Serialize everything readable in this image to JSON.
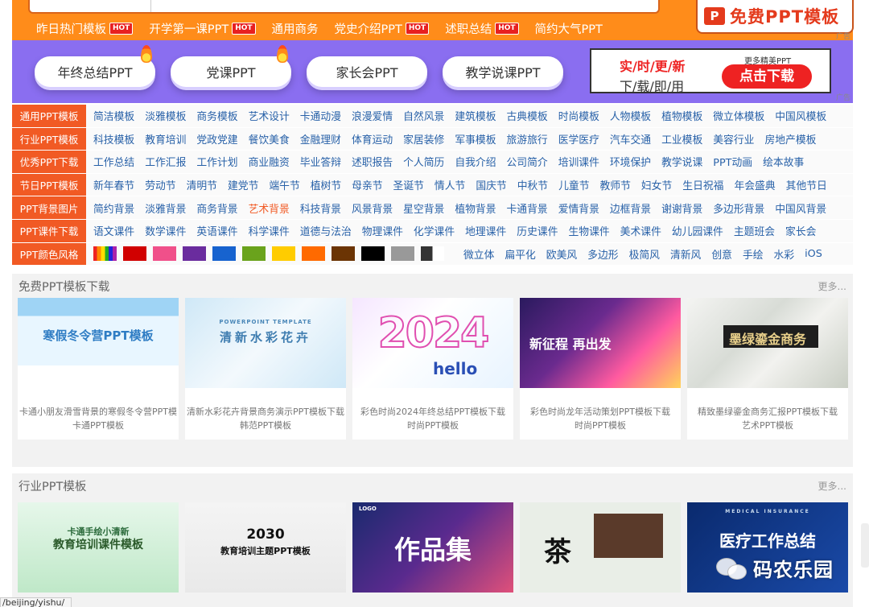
{
  "top": {
    "hotlinks": [
      {
        "label": "昨日热门模板",
        "hot": true
      },
      {
        "label": "开学第一课PPT",
        "hot": true
      },
      {
        "label": "通用商务",
        "hot": false
      },
      {
        "label": "党史介绍PPT",
        "hot": true
      },
      {
        "label": "述职总结",
        "hot": true
      },
      {
        "label": "简约大气PPT",
        "hot": false
      }
    ],
    "hot_badge": "HOT",
    "free_banner": "免费PPT模板",
    "ppt_icon": "P",
    "ad_tag": "广告"
  },
  "promo": {
    "pills": [
      {
        "label": "年终总结PPT",
        "flame": true
      },
      {
        "label": "党课PPT",
        "flame": true
      },
      {
        "label": "家长会PPT",
        "flame": false
      },
      {
        "label": "教学说课PPT",
        "flame": false
      }
    ],
    "ad_line1": "实/时/更/新",
    "ad_line2": "下/载/即/用",
    "ad_more": "更多精美PPT",
    "ad_button": "点击下载",
    "ad_tag": "广告"
  },
  "categories": [
    {
      "label": "通用PPT模板",
      "items": [
        "简洁模板",
        "淡雅模板",
        "商务模板",
        "艺术设计",
        "卡通动漫",
        "浪漫爱情",
        "自然风景",
        "建筑模板",
        "古典模板",
        "时尚模板",
        "人物模板",
        "植物模板",
        "微立体模板",
        "中国风模板"
      ]
    },
    {
      "label": "行业PPT模板",
      "items": [
        "科技模板",
        "教育培训",
        "党政党建",
        "餐饮美食",
        "金融理财",
        "体育运动",
        "家居装修",
        "军事模板",
        "旅游旅行",
        "医学医疗",
        "汽车交通",
        "工业模板",
        "美容行业",
        "房地产模板"
      ]
    },
    {
      "label": "优秀PPT下载",
      "items": [
        "工作总结",
        "工作汇报",
        "工作计划",
        "商业融资",
        "毕业答辩",
        "述职报告",
        "个人简历",
        "自我介绍",
        "公司简介",
        "培训课件",
        "环境保护",
        "教学说课",
        "PPT动画",
        "绘本故事"
      ]
    },
    {
      "label": "节日PPT模板",
      "items": [
        "新年春节",
        "劳动节",
        "清明节",
        "建党节",
        "端午节",
        "植树节",
        "母亲节",
        "圣诞节",
        "情人节",
        "国庆节",
        "中秋节",
        "儿童节",
        "教师节",
        "妇女节",
        "生日祝福",
        "年会盛典",
        "其他节日"
      ]
    },
    {
      "label": "PPT背景图片",
      "items": [
        "简约背景",
        "淡雅背景",
        "商务背景",
        "艺术背景",
        "科技背景",
        "风景背景",
        "星空背景",
        "植物背景",
        "卡通背景",
        "爱情背景",
        "边框背景",
        "谢谢背景",
        "多边形背景",
        "中国风背景"
      ],
      "active": "艺术背景"
    },
    {
      "label": "PPT课件下载",
      "items": [
        "语文课件",
        "数学课件",
        "英语课件",
        "科学课件",
        "道德与法治",
        "物理课件",
        "化学课件",
        "地理课件",
        "历史课件",
        "生物课件",
        "美术课件",
        "幼儿园课件",
        "主题班会",
        "家长会"
      ]
    }
  ],
  "colors": {
    "label": "PPT颜色风格",
    "swatches": [
      "rainbow",
      "#d10000",
      "#f0508a",
      "#6a2c9e",
      "#1763cf",
      "#6aa31c",
      "#ffcc00",
      "#ff6a00",
      "#6b3404",
      "#000000",
      "#999999",
      "#333333-#ffffff"
    ],
    "styles": [
      "微立体",
      "扁平化",
      "欧美风",
      "多边形",
      "极简风",
      "清新风",
      "创意",
      "手绘",
      "水彩",
      "iOS"
    ]
  },
  "free_section": {
    "title": "免费PPT模板下载",
    "more": "更多...",
    "cards": [
      {
        "thumb_text": "寒假冬令营PPT模板",
        "title": "卡通小朋友滑雪背景的寒假冬令营PPT模",
        "sub": "卡通PPT模板"
      },
      {
        "thumb_text": "清新水彩花卉",
        "thumb_top": "POWERPOINT TEMPLATE",
        "title": "清新水彩花卉背景商务演示PPT模板下载",
        "sub": "韩范PPT模板"
      },
      {
        "thumb_text": "2024",
        "thumb_bottom": "hello",
        "title": "彩色时尚2024年终总结PPT模板下载",
        "sub": "时尚PPT模板"
      },
      {
        "thumb_text": "新征程 再出发",
        "title": "彩色时尚龙年活动策划PPT模板下载",
        "sub": "时尚PPT模板"
      },
      {
        "thumb_text": "墨绿鎏金商务",
        "title": "精致墨绿鎏金商务汇报PPT模板下载",
        "sub": "艺术PPT模板"
      }
    ]
  },
  "industry_section": {
    "title": "行业PPT模板",
    "more": "更多...",
    "cards": [
      {
        "thumb_text": "卡通手绘小清新",
        "thumb_text2": "教育培训课件模板"
      },
      {
        "thumb_text": "2030",
        "thumb_text2": "教育培训主题PPT模板"
      },
      {
        "thumb_text": "作品集",
        "thumb_top": "LOGO"
      },
      {
        "thumb_text": "茶"
      },
      {
        "thumb_text": "医疗工作总结",
        "thumb_top": "MEDICAL INSURANCE"
      }
    ]
  },
  "status_url": "/beijing/yishu/",
  "watermark": "码农乐园"
}
